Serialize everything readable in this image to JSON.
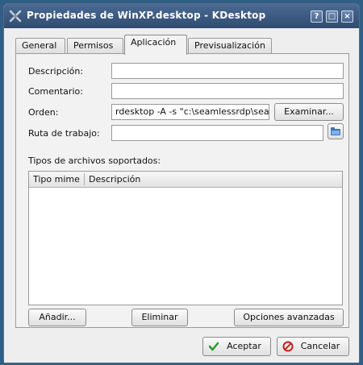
{
  "window": {
    "title": "Propiedades de WinXP.desktop - KDesktop",
    "help_glyph": "?",
    "maximize_glyph": "□",
    "close_glyph": "×"
  },
  "tabs": [
    {
      "label": "General",
      "active": false
    },
    {
      "label": "Permisos",
      "active": false
    },
    {
      "label": "Aplicación",
      "active": true
    },
    {
      "label": "Previsualización",
      "active": false
    }
  ],
  "form": {
    "descripcion_label": "Descripción:",
    "descripcion_value": "",
    "comentario_label": "Comentario:",
    "comentario_value": "",
    "orden_label": "Orden:",
    "orden_value": "rdesktop -A -s \"c:\\seamlessrdp\\seam",
    "examinar_label": "Examinar...",
    "ruta_label": "Ruta de trabajo:",
    "ruta_value": "",
    "browse_icon": "folder-icon"
  },
  "filetypes": {
    "section_label": "Tipos de archivos soportados:",
    "columns": [
      "Tipo mime",
      "Descripción"
    ],
    "rows": []
  },
  "buttons": {
    "anadir": "Añadir...",
    "eliminar": "Eliminar",
    "opciones": "Opciones avanzadas",
    "aceptar": "Aceptar",
    "cancelar": "Cancelar"
  },
  "colors": {
    "titlebar": "#3a587e",
    "accept_icon": "#2e9a2e",
    "cancel_icon": "#c82020"
  }
}
